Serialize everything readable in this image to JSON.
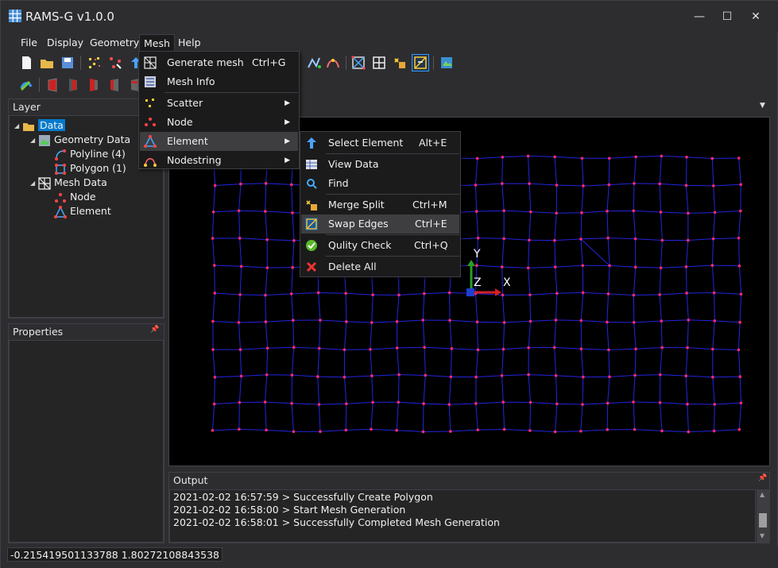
{
  "app": {
    "title": "RAMS-G v1.0.0",
    "window_buttons": {
      "minimize": "—",
      "maximize": "☐",
      "close": "✕"
    }
  },
  "menubar": {
    "items": [
      {
        "label": "File"
      },
      {
        "label": "Display"
      },
      {
        "label": "Geometry"
      },
      {
        "label": "Mesh"
      },
      {
        "label": "Help"
      }
    ],
    "active": "Mesh"
  },
  "mesh_menu": {
    "items": [
      {
        "label": "Generate mesh",
        "shortcut": "Ctrl+G",
        "icon": "generate-mesh-icon"
      },
      {
        "label": "Mesh Info",
        "icon": "mesh-info-icon"
      },
      {
        "label": "Scatter",
        "submenu": true,
        "icon": "scatter-icon"
      },
      {
        "label": "Node",
        "submenu": true,
        "icon": "node-icon"
      },
      {
        "label": "Element",
        "submenu": true,
        "icon": "element-icon",
        "highlighted": true
      },
      {
        "label": "Nodestring",
        "submenu": true,
        "icon": "nodestring-icon"
      }
    ]
  },
  "element_submenu": {
    "items": [
      {
        "label": "Select Element",
        "shortcut": "Alt+E",
        "icon": "select-element-icon"
      },
      {
        "label": "View Data",
        "icon": "view-data-icon"
      },
      {
        "label": "Find",
        "icon": "find-icon"
      },
      {
        "label": "Merge Split",
        "shortcut": "Ctrl+M",
        "icon": "merge-split-icon"
      },
      {
        "label": "Swap Edges",
        "shortcut": "Ctrl+E",
        "icon": "swap-edges-icon",
        "highlighted": true
      },
      {
        "label": "Qulity Check",
        "shortcut": "Ctrl+Q",
        "icon": "quality-check-icon"
      },
      {
        "label": "Delete All",
        "icon": "delete-all-icon"
      }
    ]
  },
  "layer_panel": {
    "title": "Layer",
    "tree": [
      {
        "label": "Data",
        "icon": "folder-icon",
        "selected": true
      },
      {
        "label": "Geometry Data",
        "icon": "geometry-data-icon"
      },
      {
        "label": "Polyline (4)",
        "icon": "polyline-icon"
      },
      {
        "label": "Polygon (1)",
        "icon": "polygon-icon"
      },
      {
        "label": "Mesh Data",
        "icon": "mesh-data-icon"
      },
      {
        "label": "Node",
        "icon": "node-icon"
      },
      {
        "label": "Element",
        "icon": "element-icon"
      }
    ]
  },
  "properties_panel": {
    "title": "Properties",
    "pin": "📌"
  },
  "viewport": {
    "axis_labels": {
      "x": "X",
      "y": "Y",
      "z": "Z"
    },
    "mesh": {
      "line_color": "#2424e0",
      "node_color": "#ff2a6d",
      "columns": 21,
      "rows": 11
    }
  },
  "output_panel": {
    "title": "Output",
    "lines": [
      "2021-02-02 16:57:59 > Successfully Create Polygon",
      "2021-02-02 16:58:00 > Start Mesh Generation",
      "2021-02-02 16:58:01 > Successfully Completed Mesh Generation"
    ]
  },
  "status": {
    "coordinates": "-0.215419501133788 1.80272108843538"
  },
  "colors": {
    "accent": "#007acc",
    "background": "#2d2d30",
    "panel": "#252526"
  }
}
